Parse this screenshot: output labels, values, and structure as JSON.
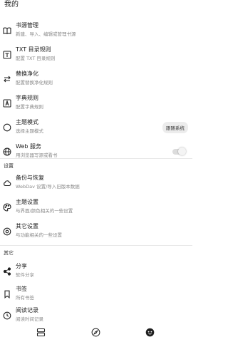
{
  "header": {
    "title": "我的"
  },
  "main_items": [
    {
      "title": "书源管理",
      "subtitle": "新建、导入、编辑或管理书源",
      "icon": "book-open-icon"
    },
    {
      "title": "TXT 目录规则",
      "subtitle": "配置 TXT 目录规则",
      "icon": "txt-icon"
    },
    {
      "title": "替换净化",
      "subtitle": "配置替换净化规则",
      "icon": "replace-icon"
    },
    {
      "title": "字典规则",
      "subtitle": "配置字典规则",
      "icon": "dictionary-icon"
    },
    {
      "title": "主题模式",
      "subtitle": "选择主题模式",
      "icon": "theme-mode-icon"
    },
    {
      "title": "Web 服务",
      "subtitle": "用浏览器写源或看书",
      "icon": "globe-icon"
    }
  ],
  "theme_mode": {
    "value": "跟随系统"
  },
  "web_service": {
    "enabled": false
  },
  "settings_section": {
    "label": "设置",
    "items": [
      {
        "title": "备份与恢复",
        "subtitle": "WebDav 设置/导入旧版本数据",
        "icon": "cloud-icon"
      },
      {
        "title": "主题设置",
        "subtitle": "与界面/颜色相关的一些设置",
        "icon": "palette-icon"
      },
      {
        "title": "其它设置",
        "subtitle": "与功能相关的一些设置",
        "icon": "settings-icon"
      }
    ]
  },
  "other_section": {
    "label": "其它",
    "items": [
      {
        "title": "分享",
        "subtitle": "软件分享",
        "icon": "share-icon"
      },
      {
        "title": "书签",
        "subtitle": "所有书签",
        "icon": "bookmark-icon"
      },
      {
        "title": "阅读记录",
        "subtitle": "阅读时间记录",
        "icon": "history-icon"
      }
    ]
  },
  "bottom_nav": [
    {
      "icon": "bookshelf-icon"
    },
    {
      "icon": "compass-icon"
    },
    {
      "icon": "profile-face-icon"
    }
  ],
  "colors": {
    "accent": "#1f1f1f",
    "subtitle": "#8a8a8a",
    "divider": "#e8e8e8",
    "chip_bg": "#ececec"
  }
}
